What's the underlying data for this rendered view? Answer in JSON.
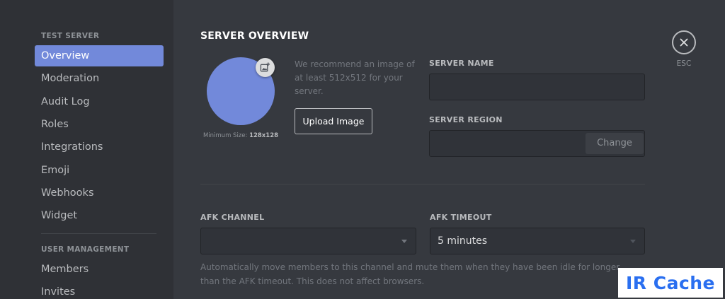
{
  "sidebar": {
    "server_header": "TEST SERVER",
    "items": [
      {
        "label": "Overview",
        "active": true
      },
      {
        "label": "Moderation"
      },
      {
        "label": "Audit Log"
      },
      {
        "label": "Roles"
      },
      {
        "label": "Integrations"
      },
      {
        "label": "Emoji"
      },
      {
        "label": "Webhooks"
      },
      {
        "label": "Widget"
      }
    ],
    "user_management_header": "USER MANAGEMENT",
    "user_items": [
      {
        "label": "Members"
      },
      {
        "label": "Invites"
      }
    ]
  },
  "main": {
    "title": "SERVER OVERVIEW",
    "avatar": {
      "min_size_prefix": "Minimum Size: ",
      "min_size_value": "128x128",
      "upload_badge_icon": "add-image-icon",
      "color": "#7289da"
    },
    "recommendation": "We recommend an image of at least 512x512 for your server.",
    "upload_button": "Upload Image",
    "server_name": {
      "label": "SERVER NAME",
      "value": ""
    },
    "server_region": {
      "label": "SERVER REGION",
      "value": "",
      "change_button": "Change"
    },
    "afk_channel": {
      "label": "AFK CHANNEL",
      "value": ""
    },
    "afk_timeout": {
      "label": "AFK TIMEOUT",
      "value": "5 minutes"
    },
    "afk_help": "Automatically move members to this channel and mute them when they have been idle for longer than the AFK timeout. This does not affect browsers."
  },
  "esc": {
    "label": "ESC",
    "icon": "close-icon"
  },
  "watermark": {
    "text": "IR Cache"
  },
  "colors": {
    "accent": "#7289da",
    "sidebar_bg": "#2f3136",
    "main_bg": "#36393f"
  }
}
